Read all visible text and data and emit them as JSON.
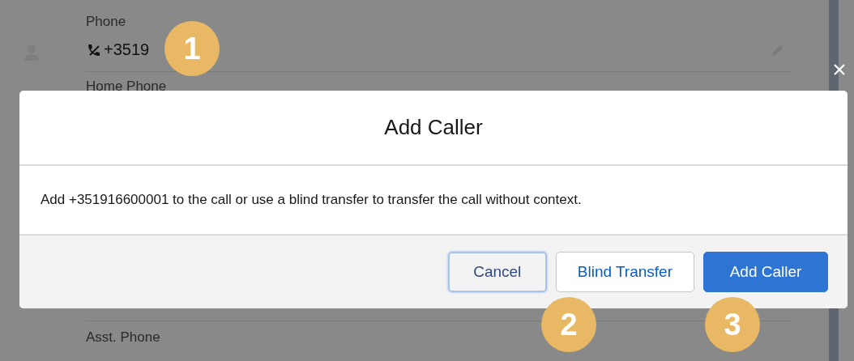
{
  "fields": [
    {
      "label": "Phone",
      "value": "+3519"
    },
    {
      "label": "Home Phone"
    },
    {
      "label": "Asst. Phone"
    }
  ],
  "modal": {
    "title": "Add Caller",
    "message": "Add +351916600001 to the call or use a blind transfer to transfer the call without context.",
    "buttons": [
      {
        "label": "Cancel",
        "kind": "neutral",
        "focused": true
      },
      {
        "label": "Blind Transfer",
        "kind": "neutral",
        "focused": false
      },
      {
        "label": "Add Caller",
        "kind": "brand",
        "focused": false
      }
    ]
  },
  "callouts": [
    {
      "number": "1"
    },
    {
      "number": "2"
    },
    {
      "number": "3"
    }
  ]
}
